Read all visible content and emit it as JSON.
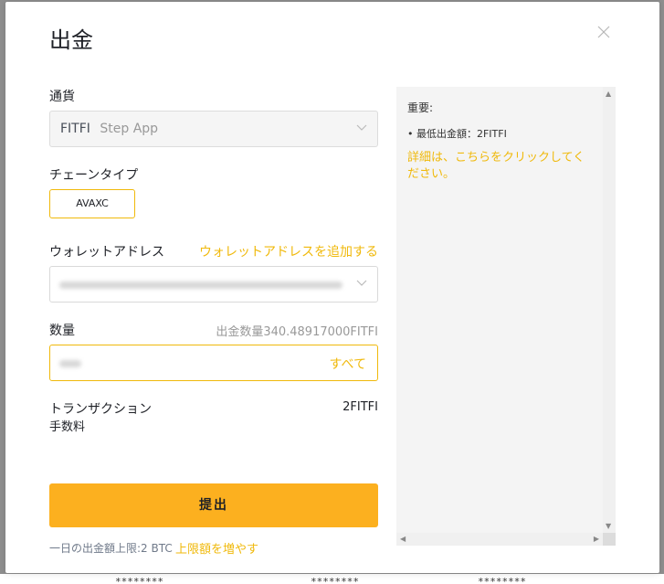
{
  "dialog": {
    "title": "出金",
    "close_label": "X"
  },
  "currency": {
    "label": "通貨",
    "symbol": "FITFI",
    "name": "Step App"
  },
  "chain": {
    "label": "チェーンタイプ",
    "selected": "AVAXC"
  },
  "address": {
    "label": "ウォレットアドレス",
    "add_link": "ウォレットアドレスを追加する"
  },
  "amount": {
    "label": "数量",
    "available": "出金数量340.48917000FITFI",
    "all_button": "すべて"
  },
  "fee": {
    "label_line1": "トランザクション",
    "label_line2": "手数料",
    "value": "2FITFI"
  },
  "submit": {
    "label": "提出"
  },
  "footer": {
    "limit_text": "一日の出金額上限:2 BTC",
    "increase_link": "上限額を増やす"
  },
  "info_panel": {
    "heading": "重要:",
    "bullet": "• 最低出金額：2FITFI",
    "details_link": "詳細は、こちらをクリックしてください。"
  },
  "backdrop": {
    "masked_values": [
      "********",
      "********",
      "********"
    ]
  },
  "colors": {
    "accent": "#f0b90b",
    "button": "#fcb01f",
    "panel": "#f4f4f4"
  }
}
